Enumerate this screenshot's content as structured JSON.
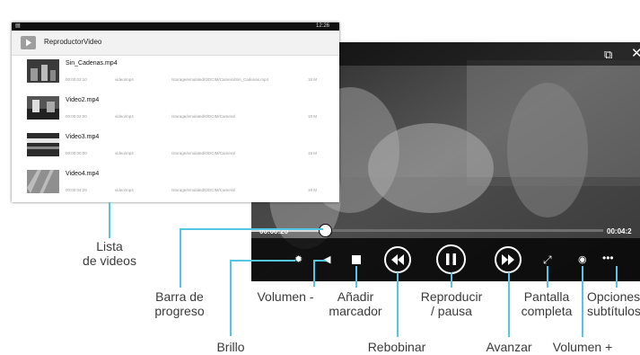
{
  "app": {
    "status_time": "12:26",
    "title": "ReproductorVideo",
    "videos": [
      {
        "name": "Sin_Cadenas.mp4",
        "duration": "00:00:02:10",
        "mime": "video/mp4",
        "path": "/storage/emulated/0/DCIM/Camera/Sin_Cadenas.mp4",
        "size": "19 M"
      },
      {
        "name": "Video2.mp4",
        "duration": "00:00:02:00",
        "mime": "video/mp4",
        "path": "/storage/emulated/0/DCIM/Camera/",
        "size": "19 M"
      },
      {
        "name": "Video3.mp4",
        "duration": "00:00:00:00",
        "mime": "video/mp4",
        "path": "/storage/emulated/0/DCIM/Camera/",
        "size": "19 M"
      },
      {
        "name": "Video4.mp4",
        "duration": "00:00:04:29",
        "mime": "video/mp4",
        "path": "/storage/emulated/0/DCIM/Camera/",
        "size": "19 M"
      }
    ]
  },
  "player": {
    "current_time": "00:00:20",
    "total_time": "00:04:2",
    "progress_fraction": 0.21
  },
  "callouts": {
    "lista": "Lista\nde videos",
    "barra": "Barra de\nprogreso",
    "volumen_menos": "Volumen -",
    "marcador": "Añadir\nmarcador",
    "reproducir": "Reproducir\n/ pausa",
    "pantalla": "Pantalla\ncompleta",
    "opciones": "Opciones\nsubtítulos",
    "brillo": "Brillo",
    "rebobinar": "Rebobinar",
    "avanzar": "Avanzar",
    "volumen_mas": "Volumen +"
  },
  "colors": {
    "callout_line": "#53c6e4",
    "player_bg": "#000000"
  }
}
